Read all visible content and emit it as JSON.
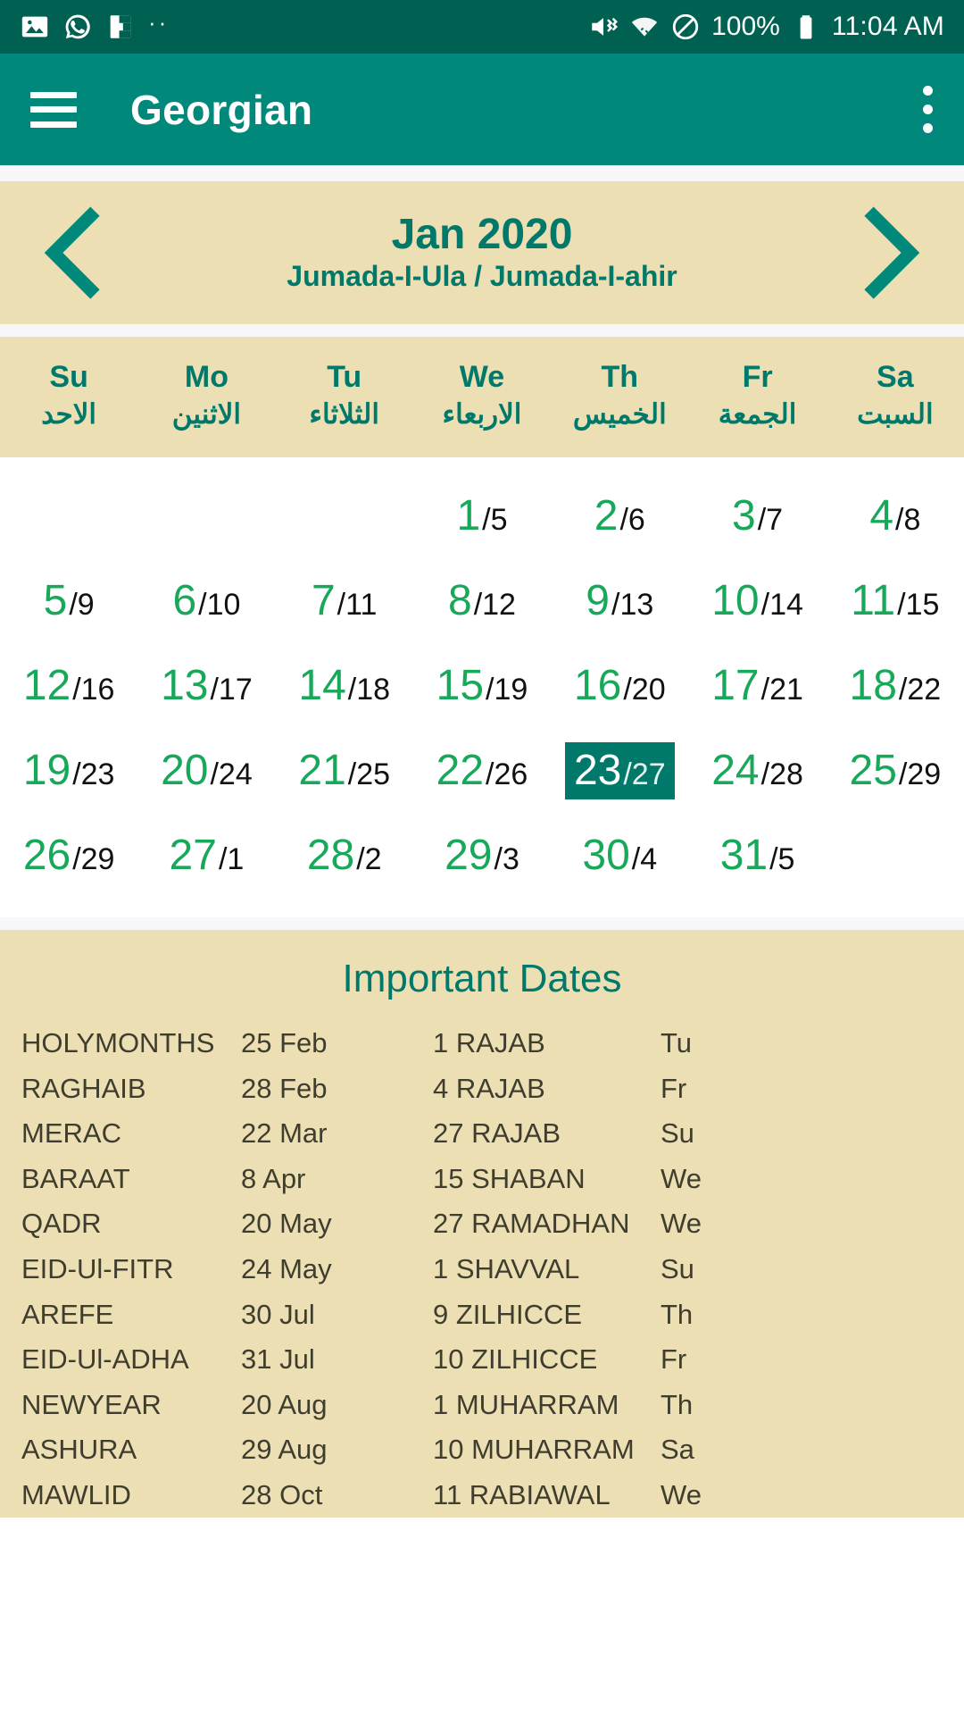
{
  "status_bar": {
    "icons": [
      "photo-icon",
      "whatsapp-icon",
      "flipboard-icon",
      "more-dots-icon"
    ],
    "mute_icon": "mute-icon",
    "wifi_icon": "wifi-icon",
    "dnd_icon": "do-not-disturb-icon",
    "battery_percent": "100%",
    "battery_icon": "battery-full-icon",
    "clock": "11:04 AM"
  },
  "app_bar": {
    "menu_icon": "hamburger-menu-icon",
    "title": "Georgian",
    "overflow_icon": "overflow-menu-icon"
  },
  "month_nav": {
    "prev_icon": "chevron-left-icon",
    "next_icon": "chevron-right-icon",
    "title": "Jan 2020",
    "subtitle": "Jumada-I-Ula / Jumada-I-ahir"
  },
  "weekdays": [
    {
      "en": "Su",
      "ar": "الاحد"
    },
    {
      "en": "Mo",
      "ar": "الاثنين"
    },
    {
      "en": "Tu",
      "ar": "الثلاثاء"
    },
    {
      "en": "We",
      "ar": "الاربعاء"
    },
    {
      "en": "Th",
      "ar": "الخميس"
    },
    {
      "en": "Fr",
      "ar": "الجمعة"
    },
    {
      "en": "Sa",
      "ar": "السبت"
    }
  ],
  "calendar": {
    "selected_gregorian": "23",
    "weeks": [
      [
        null,
        null,
        null,
        {
          "g": "1",
          "h": "/5"
        },
        {
          "g": "2",
          "h": "/6"
        },
        {
          "g": "3",
          "h": "/7"
        },
        {
          "g": "4",
          "h": "/8"
        }
      ],
      [
        {
          "g": "5",
          "h": "/9"
        },
        {
          "g": "6",
          "h": "/10"
        },
        {
          "g": "7",
          "h": "/11"
        },
        {
          "g": "8",
          "h": "/12"
        },
        {
          "g": "9",
          "h": "/13"
        },
        {
          "g": "10",
          "h": "/14"
        },
        {
          "g": "11",
          "h": "/15"
        }
      ],
      [
        {
          "g": "12",
          "h": "/16"
        },
        {
          "g": "13",
          "h": "/17"
        },
        {
          "g": "14",
          "h": "/18"
        },
        {
          "g": "15",
          "h": "/19"
        },
        {
          "g": "16",
          "h": "/20"
        },
        {
          "g": "17",
          "h": "/21"
        },
        {
          "g": "18",
          "h": "/22"
        }
      ],
      [
        {
          "g": "19",
          "h": "/23"
        },
        {
          "g": "20",
          "h": "/24"
        },
        {
          "g": "21",
          "h": "/25"
        },
        {
          "g": "22",
          "h": "/26"
        },
        {
          "g": "23",
          "h": "/27",
          "selected": true
        },
        {
          "g": "24",
          "h": "/28"
        },
        {
          "g": "25",
          "h": "/29"
        }
      ],
      [
        {
          "g": "26",
          "h": "/29"
        },
        {
          "g": "27",
          "h": "/1"
        },
        {
          "g": "28",
          "h": "/2"
        },
        {
          "g": "29",
          "h": "/3"
        },
        {
          "g": "30",
          "h": "/4"
        },
        {
          "g": "31",
          "h": "/5"
        },
        null
      ]
    ]
  },
  "important_dates": {
    "title": "Important Dates",
    "rows": [
      {
        "name": "HOLYMONTHS",
        "gregorian": "25 Feb",
        "hijri": "1 RAJAB",
        "day": "Tu"
      },
      {
        "name": "RAGHAIB",
        "gregorian": "28 Feb",
        "hijri": "4 RAJAB",
        "day": "Fr"
      },
      {
        "name": "MERAC",
        "gregorian": "22 Mar",
        "hijri": "27 RAJAB",
        "day": "Su"
      },
      {
        "name": "BARAAT",
        "gregorian": "8 Apr",
        "hijri": "15 SHABAN",
        "day": "We"
      },
      {
        "name": "QADR",
        "gregorian": "20 May",
        "hijri": "27 RAMADHAN",
        "day": "We"
      },
      {
        "name": "EID-Ul-FITR",
        "gregorian": "24 May",
        "hijri": "1 SHAVVAL",
        "day": "Su"
      },
      {
        "name": "AREFE",
        "gregorian": "30 Jul",
        "hijri": "9 ZILHICCE",
        "day": "Th"
      },
      {
        "name": "EID-Ul-ADHA",
        "gregorian": "31 Jul",
        "hijri": "10 ZILHICCE",
        "day": "Fr"
      },
      {
        "name": "NEWYEAR",
        "gregorian": "20 Aug",
        "hijri": "1 MUHARRAM",
        "day": "Th"
      },
      {
        "name": "ASHURA",
        "gregorian": "29 Aug",
        "hijri": "10 MUHARRAM",
        "day": "Sa"
      },
      {
        "name": "MAWLID",
        "gregorian": "28 Oct",
        "hijri": "11 RABIAWAL",
        "day": "We"
      }
    ]
  },
  "colors": {
    "status_bar": "#006152",
    "app_bar": "#00897b",
    "accent_teal": "#00796b",
    "beige": "#ecdfb4",
    "day_green": "#17a85a",
    "text_dark": "#3f3d2e"
  }
}
